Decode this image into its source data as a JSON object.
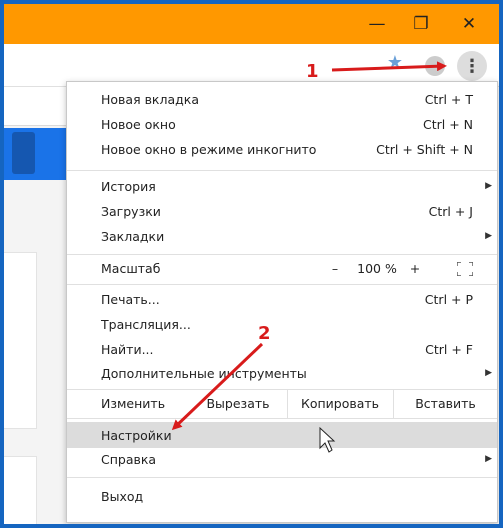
{
  "window": {
    "title_bar_color": "#ff9800",
    "minimize_glyph": "—",
    "restore_glyph": "❐",
    "close_glyph": "✕"
  },
  "toolbar": {
    "star_icon": "star-icon",
    "menu_glyph": "⋮"
  },
  "menu": {
    "new_tab": {
      "label": "Новая вкладка",
      "shortcut": "Ctrl + T"
    },
    "new_window": {
      "label": "Новое окно",
      "shortcut": "Ctrl + N"
    },
    "incognito": {
      "label": "Новое окно в режиме инкогнито",
      "shortcut": "Ctrl + Shift + N"
    },
    "history": {
      "label": "История"
    },
    "downloads": {
      "label": "Загрузки",
      "shortcut": "Ctrl + J"
    },
    "bookmarks": {
      "label": "Закладки"
    },
    "zoom": {
      "label": "Масштаб",
      "minus": "–",
      "value": "100 %",
      "plus": "+"
    },
    "print": {
      "label": "Печать...",
      "shortcut": "Ctrl + P"
    },
    "cast": {
      "label": "Трансляция..."
    },
    "find": {
      "label": "Найти...",
      "shortcut": "Ctrl + F"
    },
    "more_tools": {
      "label": "Дополнительные инструменты"
    },
    "edit": {
      "label": "Изменить",
      "cut": "Вырезать",
      "copy": "Копировать",
      "paste": "Вставить"
    },
    "settings": {
      "label": "Настройки"
    },
    "help": {
      "label": "Справка"
    },
    "exit": {
      "label": "Выход"
    },
    "submenu_arrow": "▶"
  },
  "annotations": {
    "step1": "1",
    "step2": "2",
    "color": "#d81b1b"
  }
}
